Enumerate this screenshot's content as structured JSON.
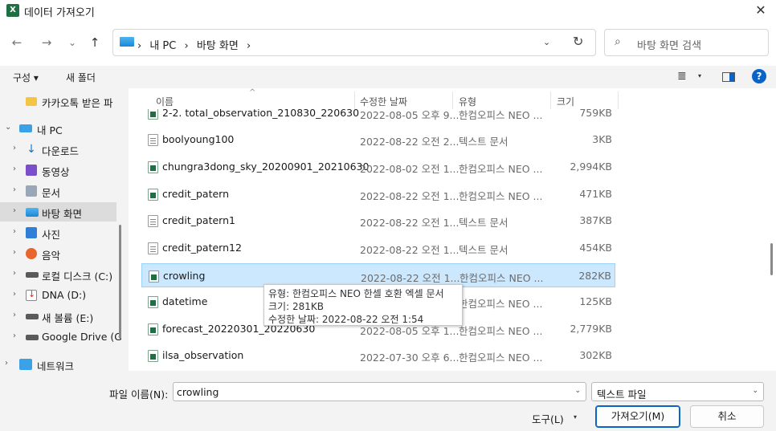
{
  "window": {
    "app_icon_letter": "X",
    "title": "데이터 가져오기",
    "close": "✕"
  },
  "nav": {
    "back": "←",
    "forward": "→",
    "recent": "⌄",
    "up": "↑",
    "crumbs": [
      "›",
      "내 PC",
      "›",
      "바탕 화면",
      "›"
    ],
    "address_dropdown": "⌄",
    "refresh": "↻",
    "search_icon": "⌕",
    "search_placeholder": "바탕 화면 검색"
  },
  "commands": {
    "organize": "구성 ▾",
    "new_folder": "새 폴더",
    "view_icon": "≣",
    "view_dropdown": "▾",
    "help": "?"
  },
  "sidebar": {
    "items": [
      {
        "chevron": "",
        "icon": "folder",
        "label": "카카오톡 받은 파"
      },
      {
        "chevron": "⌄",
        "icon": "pc",
        "label": "내 PC"
      },
      {
        "chevron": "›",
        "icon": "download",
        "label": "다운로드"
      },
      {
        "chevron": "›",
        "icon": "video",
        "label": "동영상"
      },
      {
        "chevron": "›",
        "icon": "document",
        "label": "문서"
      },
      {
        "chevron": "›",
        "icon": "desktop",
        "label": "바탕 화면",
        "selected": true
      },
      {
        "chevron": "›",
        "icon": "photo",
        "label": "사진"
      },
      {
        "chevron": "›",
        "icon": "music",
        "label": "음악"
      },
      {
        "chevron": "›",
        "icon": "drive",
        "label": "로컬 디스크 (C:)"
      },
      {
        "chevron": "›",
        "icon": "removable-drive",
        "label": "DNA (D:)"
      },
      {
        "chevron": "›",
        "icon": "drive",
        "label": "새 볼륨 (E:)"
      },
      {
        "chevron": "›",
        "icon": "drive",
        "label": "Google Drive (G"
      },
      {
        "chevron": "›",
        "icon": "network",
        "label": "네트워크"
      }
    ]
  },
  "columns": {
    "name": "이름",
    "date": "수정한 날짜",
    "type": "유형",
    "size": "크기"
  },
  "files": [
    {
      "name": "2-2. total_observation_210830_220630",
      "date": "2022-08-05 오후 9...",
      "type": "한컴오피스 NEO ...",
      "size": "759KB",
      "icon": "xls"
    },
    {
      "name": "boolyoung100",
      "date": "2022-08-22 오전 2...",
      "type": "텍스트 문서",
      "size": "3KB",
      "icon": "txt"
    },
    {
      "name": "chungra3dong_sky_20200901_20210630",
      "date": "2022-08-02 오전 1...",
      "type": "한컴오피스 NEO ...",
      "size": "2,994KB",
      "icon": "xls"
    },
    {
      "name": "credit_patern",
      "date": "2022-08-22 오전 1...",
      "type": "한컴오피스 NEO ...",
      "size": "471KB",
      "icon": "xls"
    },
    {
      "name": "credit_patern1",
      "date": "2022-08-22 오전 1...",
      "type": "텍스트 문서",
      "size": "387KB",
      "icon": "txt"
    },
    {
      "name": "credit_patern12",
      "date": "2022-08-22 오전 1...",
      "type": "텍스트 문서",
      "size": "454KB",
      "icon": "txt"
    },
    {
      "name": "crowling",
      "date": "2022-08-22 오전 1...",
      "type": "한컴오피스 NEO ...",
      "size": "282KB",
      "icon": "xls",
      "selected": true
    },
    {
      "name": "datetime",
      "date": "",
      "type": "한컴오피스 NEO ...",
      "size": "125KB",
      "icon": "xls"
    },
    {
      "name": "forecast_20220301_20220630",
      "date": "2022-08-05 오후 1...",
      "type": "한컴오피스 NEO ...",
      "size": "2,779KB",
      "icon": "xls"
    },
    {
      "name": "ilsa_observation",
      "date": "2022-07-30 오후 6...",
      "type": "한컴오피스 NEO ...",
      "size": "302KB",
      "icon": "xls"
    }
  ],
  "tooltip": {
    "type": "유형: 한컴오피스 NEO 한셀 호환 엑셀 문서",
    "size": "크기: 281KB",
    "modified": "수정한 날짜: 2022-08-22 오전 1:54"
  },
  "footer": {
    "filename_label": "파일 이름(N):",
    "filename_value": "crowling",
    "filename_dropdown": "⌄",
    "filetype_value": "텍스트 파일",
    "filetype_dropdown": "⌄",
    "tools_label": "도구(L)",
    "tools_dropdown": "▾",
    "open_label": "가져오기(M)",
    "cancel_label": "취소"
  }
}
